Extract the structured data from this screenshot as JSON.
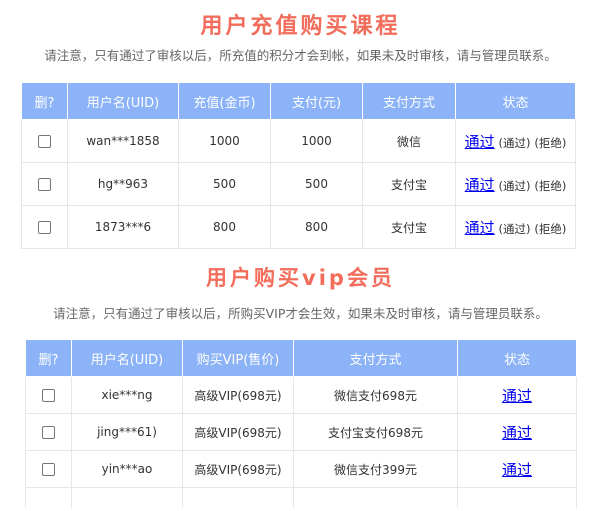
{
  "recharge": {
    "title": "用户充值购买课程",
    "notice": "请注意，只有通过了审核以后，所充值的积分才会到帐，如果未及时审核，请与管理员联系。",
    "headers": [
      "删?",
      "用户名(UID)",
      "充值(金币)",
      "支付(元)",
      "支付方式",
      "状态"
    ],
    "rows": [
      {
        "user": "wan***1858",
        "coins": "1000",
        "paid": "1000",
        "method": "微信",
        "status_link": "通过",
        "approve": "(通过)",
        "reject": "(拒绝)"
      },
      {
        "user": "hg**963",
        "coins": "500",
        "paid": "500",
        "method": "支付宝",
        "status_link": "通过",
        "approve": "(通过)",
        "reject": "(拒绝)"
      },
      {
        "user": "1873***6",
        "coins": "800",
        "paid": "800",
        "method": "支付宝",
        "status_link": "通过",
        "approve": "(通过)",
        "reject": "(拒绝)"
      }
    ]
  },
  "vip": {
    "title": "用户购买vip会员",
    "notice": "请注意，只有通过了审核以后，所购买VIP才会生效，如果未及时审核，请与管理员联系。",
    "headers": [
      "删?",
      "用户名(UID)",
      "购买VIP(售价)",
      "支付方式",
      "状态"
    ],
    "rows": [
      {
        "user": "xie***ng",
        "plan": "高级VIP(698元)",
        "method": "微信支付698元",
        "status_link": "通过"
      },
      {
        "user": "jing***61)",
        "plan": "高级VIP(698元)",
        "method": "支付宝支付698元",
        "status_link": "通过"
      },
      {
        "user": "yin***ao",
        "plan": "高级VIP(698元)",
        "method": "微信支付399元",
        "status_link": "通过"
      }
    ]
  }
}
